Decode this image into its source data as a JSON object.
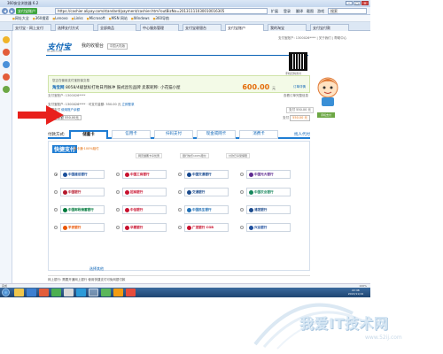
{
  "browser": {
    "title": "360安全浏览器 6.2",
    "tab_badge": "支付宝账户",
    "url": "https://cashier.alipay.com/standard/payment/cashier.htm?outBizNo=20131111030010016305",
    "toolbar_items": [
      "扩展",
      "登录",
      "翻译",
      "截图",
      "游戏"
    ],
    "search_placeholder": "搜索",
    "window_buttons": [
      "–",
      "□",
      "×"
    ],
    "favorites": [
      "网址大全",
      "360搜索",
      "Lenovo",
      "Links",
      "Microsoft",
      "MSN 网站",
      "Windows",
      "360导航"
    ],
    "tabs": [
      "支付宝 - 网上支付",
      "选择支付方式",
      "全部商品",
      "中心服务管理",
      "支付宝收银台",
      "支付宝账户",
      "我的淘宝",
      "支付宝付款"
    ]
  },
  "header": {
    "logo": "支付宝",
    "logo_sub": "ALIPAY.COM",
    "page_title": "我的收银台",
    "lang_select": "中国大陆版",
    "top_right": "支付宝账户: 1300026****  |  关于我们  |  帮助中心"
  },
  "order": {
    "notice": "您正在使用支付宝担保交易",
    "merchant": "淘宝网",
    "name": "8058/4级鼠标打地日月脉冲  鼓式昌包品牌",
    "seller": "卖家昵称: 小花猫小屋",
    "amount": "600.00",
    "amount_unit": "元",
    "sub_link": "订单详情",
    "detail_left": "支付宝账户: 1300026****",
    "detail_right": "查看订单完整信息"
  },
  "qr": {
    "caption": "手机扫码支付"
  },
  "green_button": "手机支付",
  "account": {
    "line1": "支付宝账户: 1300026****  ·  可支付金额: 550.00 元",
    "login_link": "立即登录",
    "line2": "余额支付",
    "line2_link": "使用账户余额",
    "line2_box": "支付 550.00 元",
    "balance_label": "账户余额 550.00元",
    "balance_right_label": "支付",
    "balance_right_value": "550.00 元"
  },
  "payment": {
    "label": "付款方式:",
    "tabs": [
      "储蓄卡",
      "信用卡",
      "扫码支付",
      "现金或网卡",
      "消费卡"
    ],
    "other_link": "找人代付",
    "kuaijie_logo": "快捷支付",
    "kuaijie_sub": "含卡通·100%赔付",
    "promos": [
      "网页储蓄卡享优惠",
      "银行快乐100%赔付",
      "付款已享受保障"
    ],
    "banks": [
      {
        "name": "中国建设银行",
        "color": "#1a4e9a",
        "selected": true
      },
      {
        "name": "中国工商银行",
        "color": "#c8102e",
        "selected": false
      },
      {
        "name": "中国交通银行",
        "color": "#12458d",
        "selected": false
      },
      {
        "name": "中国光大银行",
        "color": "#5e2b91",
        "selected": false
      },
      {
        "name": "中国银行",
        "color": "#b4172b",
        "selected": false
      },
      {
        "name": "招商银行",
        "color": "#c8102e",
        "selected": false
      },
      {
        "name": "交通银行",
        "color": "#1b4a8c",
        "selected": false
      },
      {
        "name": "中国农业银行",
        "color": "#15865c",
        "selected": false
      },
      {
        "name": "中国邮政储蓄银行",
        "color": "#007a3d",
        "selected": false
      },
      {
        "name": "中信银行",
        "color": "#c8102e",
        "selected": false
      },
      {
        "name": "中国民生银行",
        "color": "#1f6fb5",
        "selected": false
      },
      {
        "name": "浦发银行",
        "color": "#1b4a8c",
        "selected": false
      },
      {
        "name": "平安银行",
        "color": "#ea5504",
        "selected": false
      },
      {
        "name": "华夏银行",
        "color": "#c8102e",
        "selected": false
      },
      {
        "name": "广发银行 CGB",
        "color": "#c8102e",
        "selected": false
      },
      {
        "name": "兴业银行",
        "color": "#1f4f9e",
        "selected": false
      }
    ],
    "more_banks": "选择其他",
    "netbank_note": "网上银行:   需要开通网上银行    使用快捷支付可免网银付款"
  },
  "statusbar": {
    "left": "完成",
    "zoom": "100%"
  },
  "taskbar": {
    "time": "22:46",
    "date": "2013/11/19"
  },
  "watermark": {
    "text": "我爱IT技术网",
    "url": "www.52ij.com"
  },
  "colors": {
    "alipay_blue": "#0b63b6",
    "accent_orange": "#e46c0a",
    "tab_blue": "#1f7dd3",
    "arrow_red": "#e8201c"
  }
}
